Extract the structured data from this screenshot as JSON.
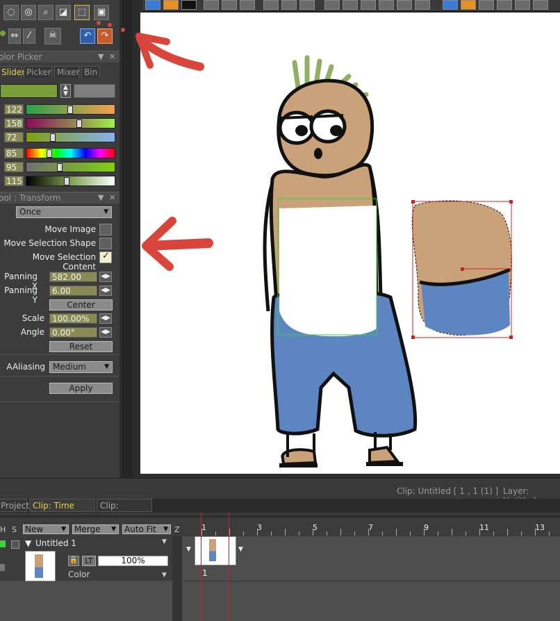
{
  "color_picker": {
    "title": "olor Picker",
    "tabs": [
      "Slider",
      "Picker",
      "Mixer",
      "Bin"
    ],
    "active_tab": "Slider",
    "current_color": "#7a9e3a",
    "sliders": [
      {
        "value": "122",
        "gradient": "linear-gradient(90deg,#2aa04a,#f0a050)",
        "level": 0.49
      },
      {
        "value": "158",
        "gradient": "linear-gradient(90deg,#8a0a5a,#9ef04a)",
        "level": 0.6
      },
      {
        "value": "72",
        "gradient": "linear-gradient(90deg,#7ea010,#8ab0f0)",
        "level": 0.28
      },
      {
        "value": "85",
        "gradient": "linear-gradient(90deg,#ff0000,#ffff00,#00ff00,#00ffff,#0000ff,#ff00ff,#ff0000)",
        "level": 0.24
      },
      {
        "value": "95",
        "gradient": "linear-gradient(90deg,#707070,#80d010)",
        "level": 0.37
      },
      {
        "value": "115",
        "gradient": "linear-gradient(90deg,#000000,#7ea050,#ffffff)",
        "level": 0.45
      }
    ]
  },
  "transform": {
    "title": "ool : Transform",
    "mode": "Once",
    "options": [
      {
        "label": "Move Image",
        "checked": false
      },
      {
        "label": "Move Selection Shape",
        "checked": false
      },
      {
        "label": "Move Selection Content",
        "checked": true
      }
    ],
    "panning_x_label": "Panning X",
    "panning_x": "582.00",
    "panning_y_label": "Panning Y",
    "panning_y": "6.00",
    "center_label": "Center",
    "scale_label": "Scale",
    "scale": "100.00%",
    "angle_label": "Angle",
    "angle": "0.00°",
    "reset_label": "Reset",
    "aaliasing_label": "AAliasing",
    "aaliasing": "Medium",
    "apply_label": "Apply"
  },
  "status": {
    "clip": "Clip: Untitled [ 1 , 1  (1) ]",
    "layer": "Layer: Untitled"
  },
  "bottom_tabs": [
    "Project",
    "Clip: Time Line",
    "Clip: XSheet"
  ],
  "timeline": {
    "col_h": "H",
    "col_s": "S",
    "new_label": "New",
    "merge_label": "Merge",
    "autofit_label": "Auto Fit",
    "col_z": "Z",
    "layer_name": "Untitled 1",
    "opacity": "100%",
    "lt_label": "LT",
    "mode": "Color",
    "frame_numbers": [
      "1",
      "3",
      "5",
      "7",
      "9",
      "11",
      "13"
    ],
    "frame_label": "1"
  },
  "colors": {
    "accent_tab": "#e8d24a",
    "annotation_arrow": "#d9453a",
    "selection_green": "#3fcf3f",
    "selection_red": "#cc2222"
  },
  "icons": [
    "lasso-icon",
    "lasso-poly-icon",
    "zoom-icon",
    "crop-icon",
    "transform-icon",
    "camera-icon",
    "eyedropper-icon",
    "skull-icon",
    "undo-icon",
    "redo-icon",
    "close-icon",
    "menu-icon"
  ]
}
